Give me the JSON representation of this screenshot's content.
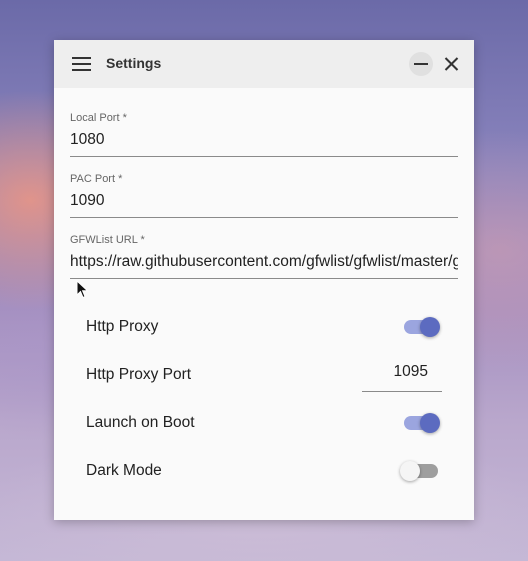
{
  "window": {
    "title": "Settings"
  },
  "fields": {
    "local_port": {
      "label": "Local Port *",
      "value": "1080"
    },
    "pac_port": {
      "label": "PAC Port *",
      "value": "1090"
    },
    "gfwlist_url": {
      "label": "GFWList URL *",
      "value": "https://raw.githubusercontent.com/gfwlist/gfwlist/master/gfwlist.txt"
    }
  },
  "settings": {
    "http_proxy": {
      "label": "Http Proxy",
      "enabled": true
    },
    "http_proxy_port": {
      "label": "Http Proxy Port",
      "value": "1095"
    },
    "launch_on_boot": {
      "label": "Launch on Boot",
      "enabled": true
    },
    "dark_mode": {
      "label": "Dark Mode",
      "enabled": false
    }
  },
  "colors": {
    "accent": "#5c6bc0",
    "accent_track": "#9ba5df",
    "titlebar": "#eeeeee",
    "surface": "#fafafa"
  },
  "icons": [
    "menu-icon",
    "minimize-icon",
    "close-icon",
    "mouse-cursor-icon"
  ]
}
